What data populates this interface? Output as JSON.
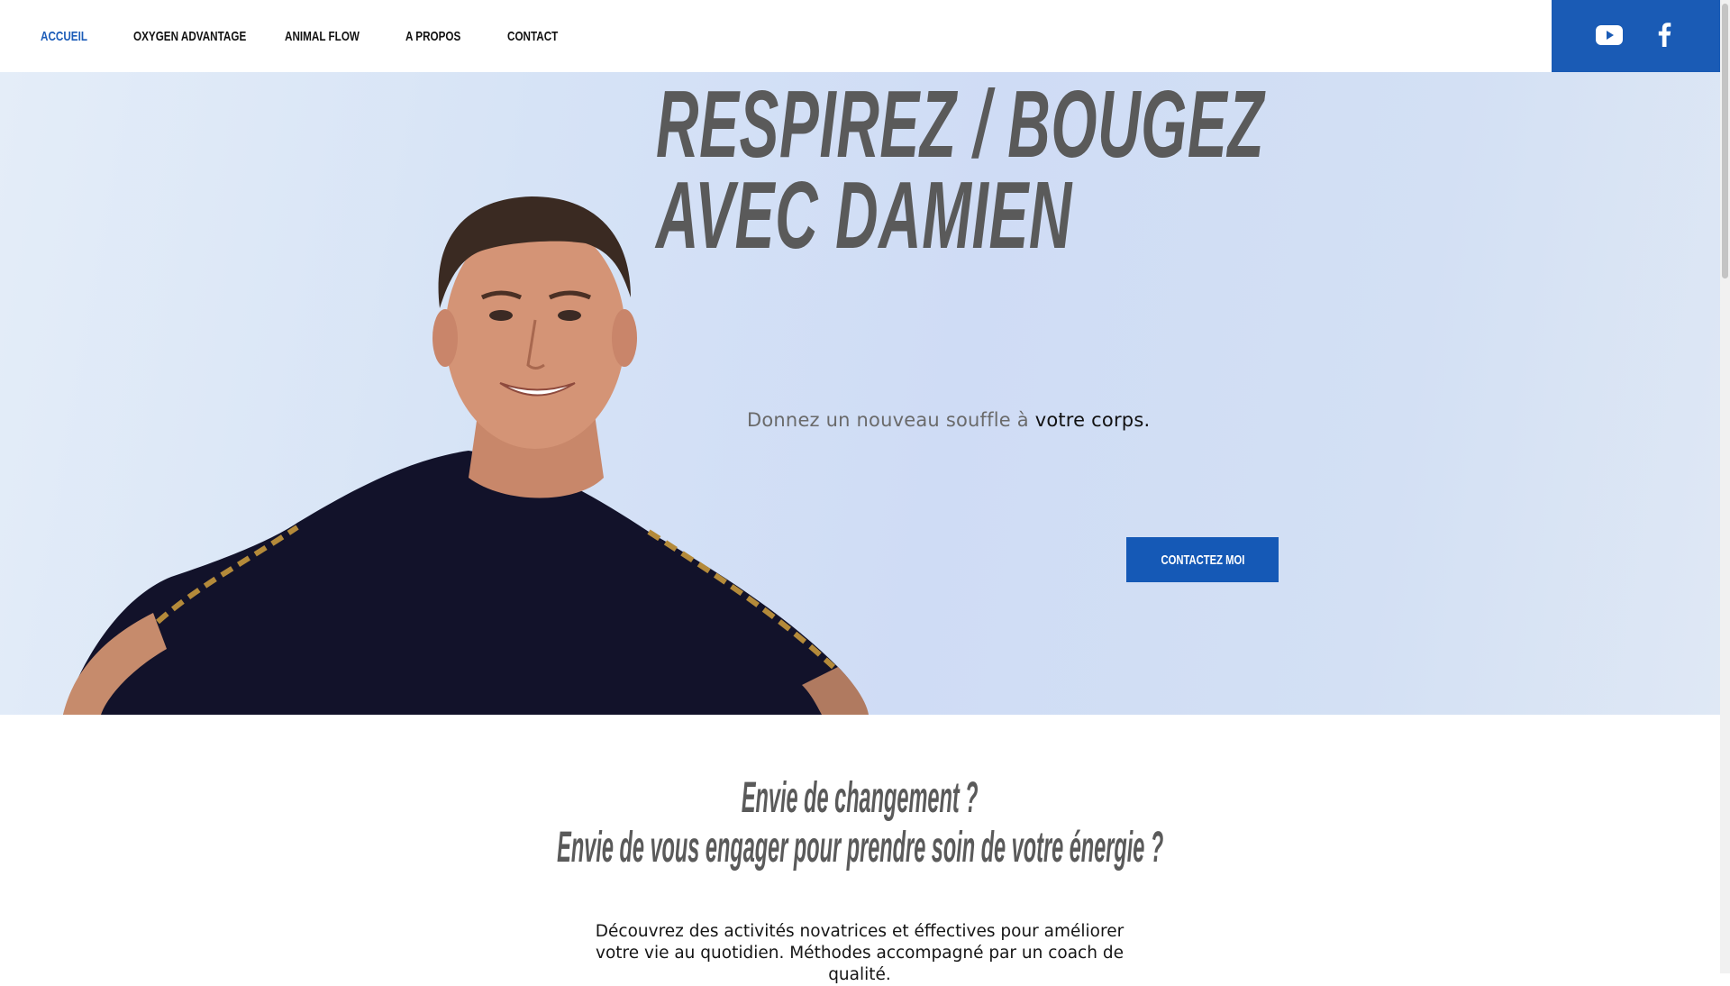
{
  "nav": {
    "items": [
      {
        "label": "ACCUEIL",
        "active": true
      },
      {
        "label": "OXYGEN ADVANTAGE",
        "active": false
      },
      {
        "label": "ANIMAL FLOW",
        "active": false
      },
      {
        "label": "A PROPOS",
        "active": false
      },
      {
        "label": "CONTACT",
        "active": false
      }
    ]
  },
  "social": {
    "icons": [
      "youtube-icon",
      "facebook-icon"
    ],
    "background": "#1a5bb5"
  },
  "hero": {
    "title_line1": "RESPIREZ / BOUGEZ",
    "title_line2": "AVEC DAMIEN",
    "subtitle_part1": "Donnez un nouveau souffle à ",
    "subtitle_part2": "votre corps.",
    "cta_label": "CONTACTEZ MOI"
  },
  "section2": {
    "title_line1": "Envie de changement ?",
    "title_line2": "Envie de vous engager pour prendre soin de votre énergie ?",
    "body": "Découvrez des activités novatrices et éffectives pour améliorer votre vie au quotidien. Méthodes accompagné par un coach de qualité."
  },
  "colors": {
    "accent": "#1559b6",
    "active_nav": "#1c5cb8",
    "heading_gray": "#5a5a5a"
  }
}
